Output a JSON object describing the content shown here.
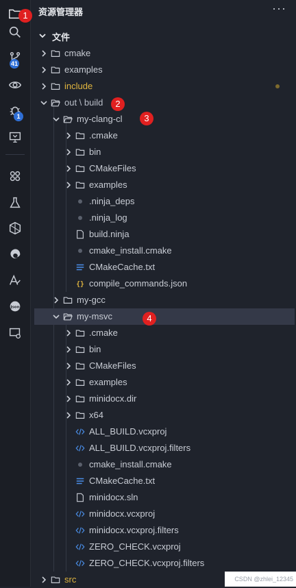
{
  "explorer": {
    "title": "资源管理器",
    "more": "···",
    "section_title": "文件"
  },
  "activity_bar": {
    "scm_badge": "41",
    "debug_badge": "1"
  },
  "markers": [
    "1",
    "2",
    "3",
    "4"
  ],
  "tree": {
    "cmake": "cmake",
    "examples": "examples",
    "include": "include",
    "out_build": "out \\ build",
    "my_clang_cl": "my-clang-cl",
    "clang_children": [
      ".cmake",
      "bin",
      "CMakeFiles",
      "examples",
      ".ninja_deps",
      ".ninja_log",
      "build.ninja",
      "cmake_install.cmake",
      "CMakeCache.txt",
      "compile_commands.json"
    ],
    "my_gcc": "my-gcc",
    "my_msvc": "my-msvc",
    "msvc_children": [
      ".cmake",
      "bin",
      "CMakeFiles",
      "examples",
      "minidocx.dir",
      "x64",
      "ALL_BUILD.vcxproj",
      "ALL_BUILD.vcxproj.filters",
      "cmake_install.cmake",
      "CMakeCache.txt",
      "minidocx.sln",
      "minidocx.vcxproj",
      "minidocx.vcxproj.filters",
      "ZERO_CHECK.vcxproj",
      "ZERO_CHECK.vcxproj.filters"
    ],
    "src": "src"
  },
  "watermark": "CSDN @zhlei_12345"
}
